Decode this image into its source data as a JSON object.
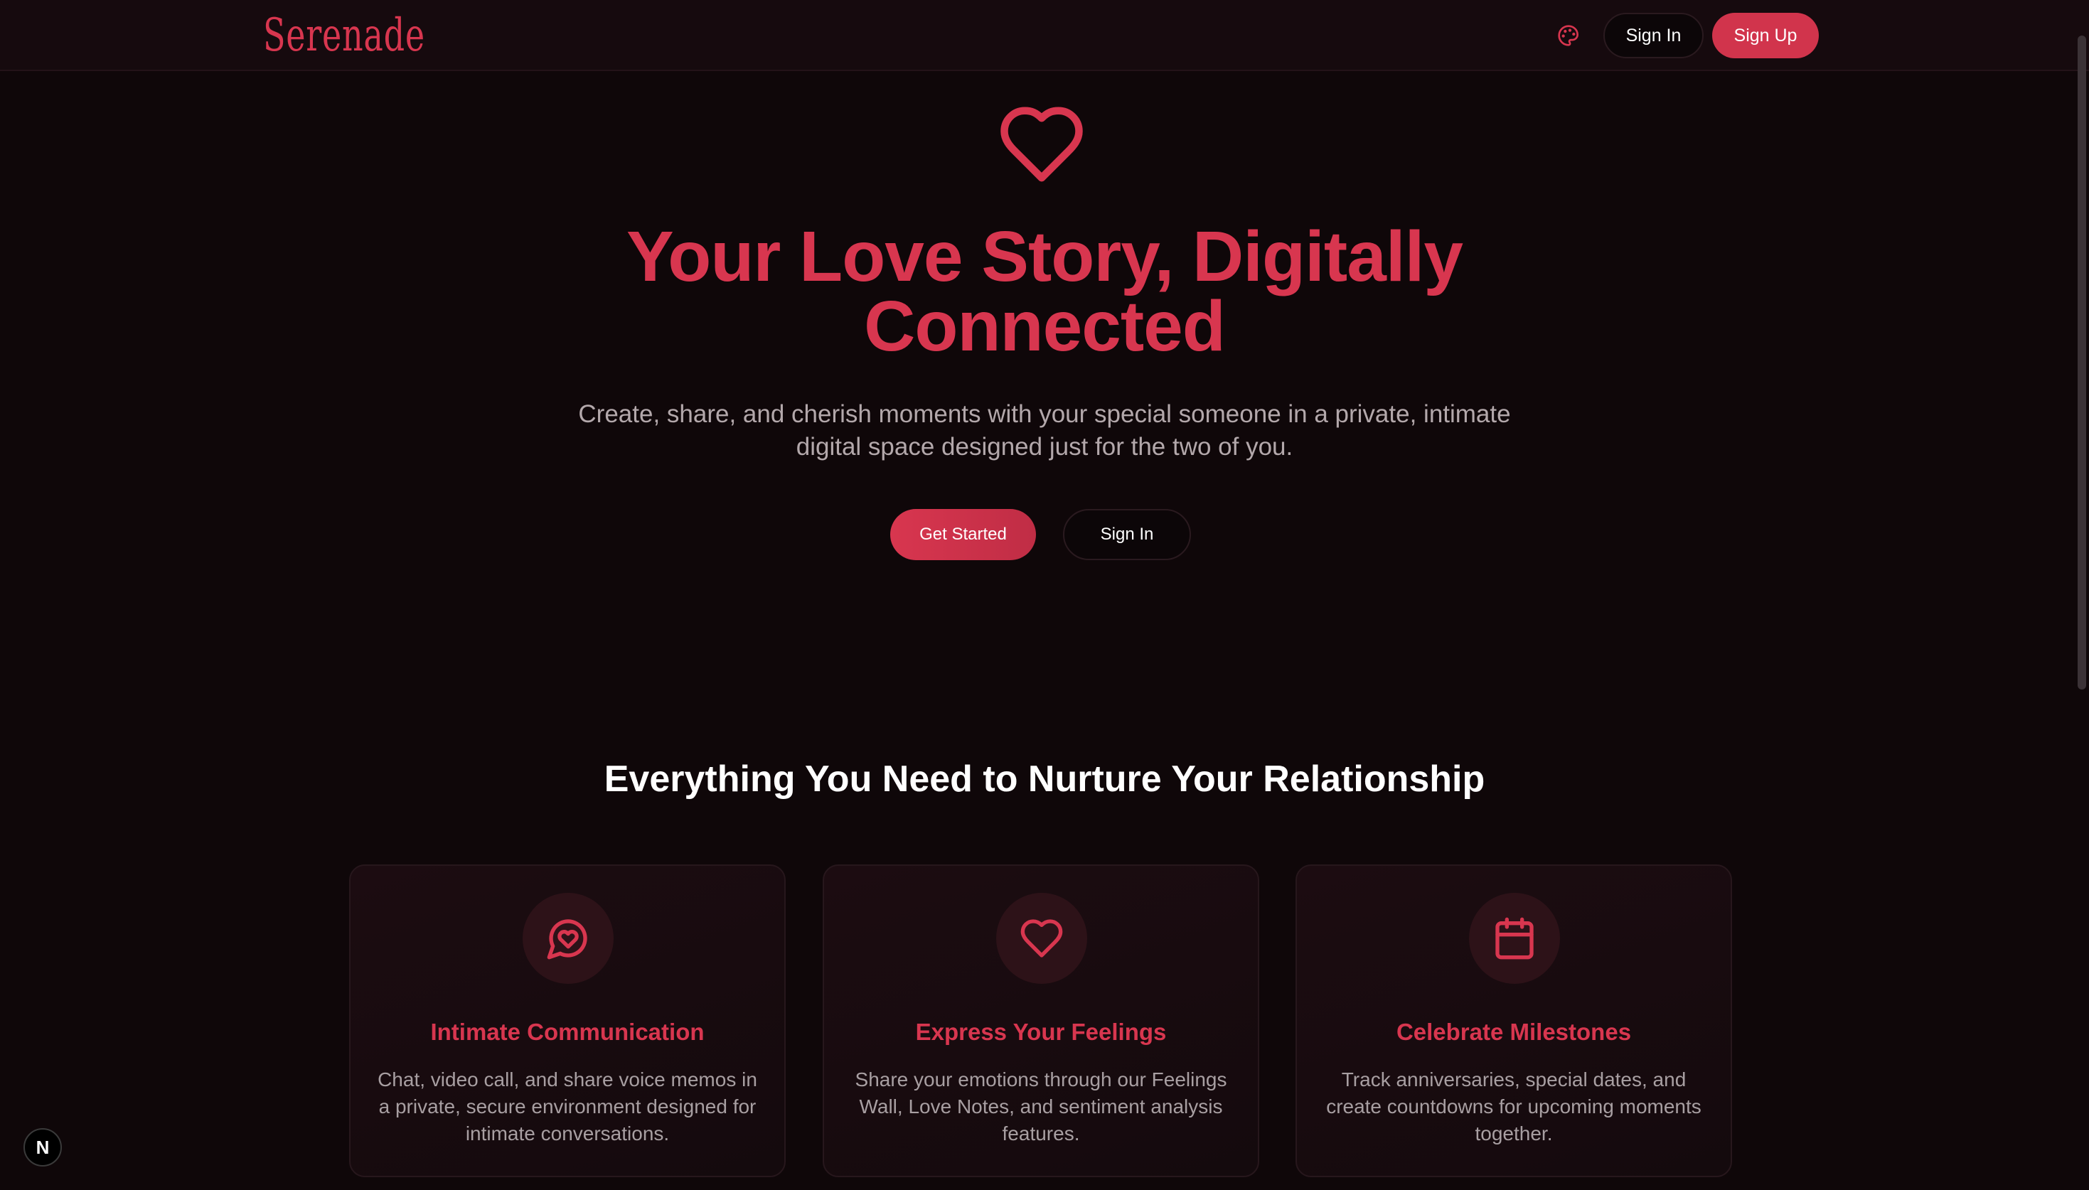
{
  "nav": {
    "brand": "Serenade",
    "theme_icon": "palette-icon",
    "sign_in_label": "Sign In",
    "sign_up_label": "Sign Up"
  },
  "hero": {
    "icon": "heart-icon",
    "title": "Your Love Story, Digitally Connected",
    "subtitle": "Create, share, and cherish moments with your special someone in a private, intimate digital space designed just for the two of you.",
    "primary_cta": "Get Started",
    "secondary_cta": "Sign In"
  },
  "features": {
    "heading": "Everything You Need to Nurture Your Relationship",
    "items": [
      {
        "icon": "message-heart-icon",
        "title": "Intimate Communication",
        "description": "Chat, video call, and share voice memos in a private, secure environment designed for intimate conversations."
      },
      {
        "icon": "heart-icon",
        "title": "Express Your Feelings",
        "description": "Share your emotions through our Feelings Wall, Love Notes, and sentiment analysis features."
      },
      {
        "icon": "calendar-icon",
        "title": "Celebrate Milestones",
        "description": "Track anniversaries, special dates, and create countdowns for upcoming moments together."
      }
    ]
  },
  "dev_badge": {
    "label": "N"
  },
  "colors": {
    "accent": "#d8364f",
    "background": "#0f0709",
    "navbar": "#160a0e",
    "card": "#1a0b10",
    "muted_text": "#b3a8ab"
  }
}
